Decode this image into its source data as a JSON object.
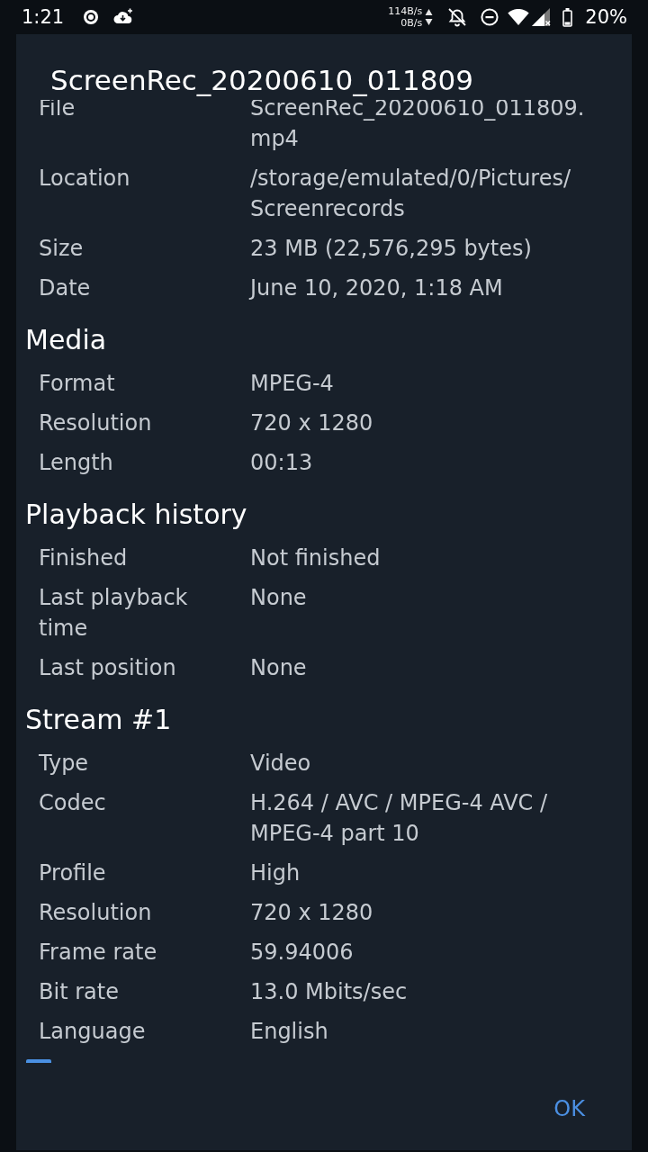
{
  "status_bar": {
    "time": "1:21",
    "upload_speed": "114B/s",
    "download_speed": "0B/s",
    "battery_percent": "20%"
  },
  "dialog": {
    "title": "ScreenRec_20200610_011809",
    "sections": [
      {
        "rows": [
          {
            "label": [
              "File"
            ],
            "value": [
              "ScreenRec_20200610_011809.",
              "mp4"
            ]
          },
          {
            "label": [
              "Location"
            ],
            "value": [
              "/storage/emulated/0/Pictures/",
              "Screenrecords"
            ]
          },
          {
            "label": [
              "Size"
            ],
            "value": [
              "23 MB (22,576,295 bytes)"
            ]
          },
          {
            "label": [
              "Date"
            ],
            "value": [
              "June 10, 2020, 1:18 AM"
            ]
          }
        ]
      },
      {
        "heading": "Media",
        "rows": [
          {
            "label": [
              "Format"
            ],
            "value": [
              "MPEG-4"
            ]
          },
          {
            "label": [
              "Resolution"
            ],
            "value": [
              "720 x 1280"
            ]
          },
          {
            "label": [
              "Length"
            ],
            "value": [
              "00:13"
            ]
          }
        ]
      },
      {
        "heading": "Playback history",
        "rows": [
          {
            "label": [
              "Finished"
            ],
            "value": [
              "Not finished"
            ]
          },
          {
            "label": [
              "Last playback",
              "time"
            ],
            "value": [
              "None"
            ]
          },
          {
            "label": [
              "Last position"
            ],
            "value": [
              "None"
            ]
          }
        ]
      },
      {
        "heading": "Stream #1",
        "rows": [
          {
            "label": [
              "Type"
            ],
            "value": [
              "Video"
            ]
          },
          {
            "label": [
              "Codec"
            ],
            "value": [
              "H.264 / AVC / MPEG-4 AVC /",
              "MPEG-4 part 10"
            ]
          },
          {
            "label": [
              "Profile"
            ],
            "value": [
              "High"
            ]
          },
          {
            "label": [
              "Resolution"
            ],
            "value": [
              "720 x 1280"
            ]
          },
          {
            "label": [
              "Frame rate"
            ],
            "value": [
              "59.94006"
            ]
          },
          {
            "label": [
              "Bit rate"
            ],
            "value": [
              "13.0 Mbits/sec"
            ]
          },
          {
            "label": [
              "Language"
            ],
            "value": [
              "English"
            ]
          }
        ]
      }
    ],
    "button": "OK"
  }
}
